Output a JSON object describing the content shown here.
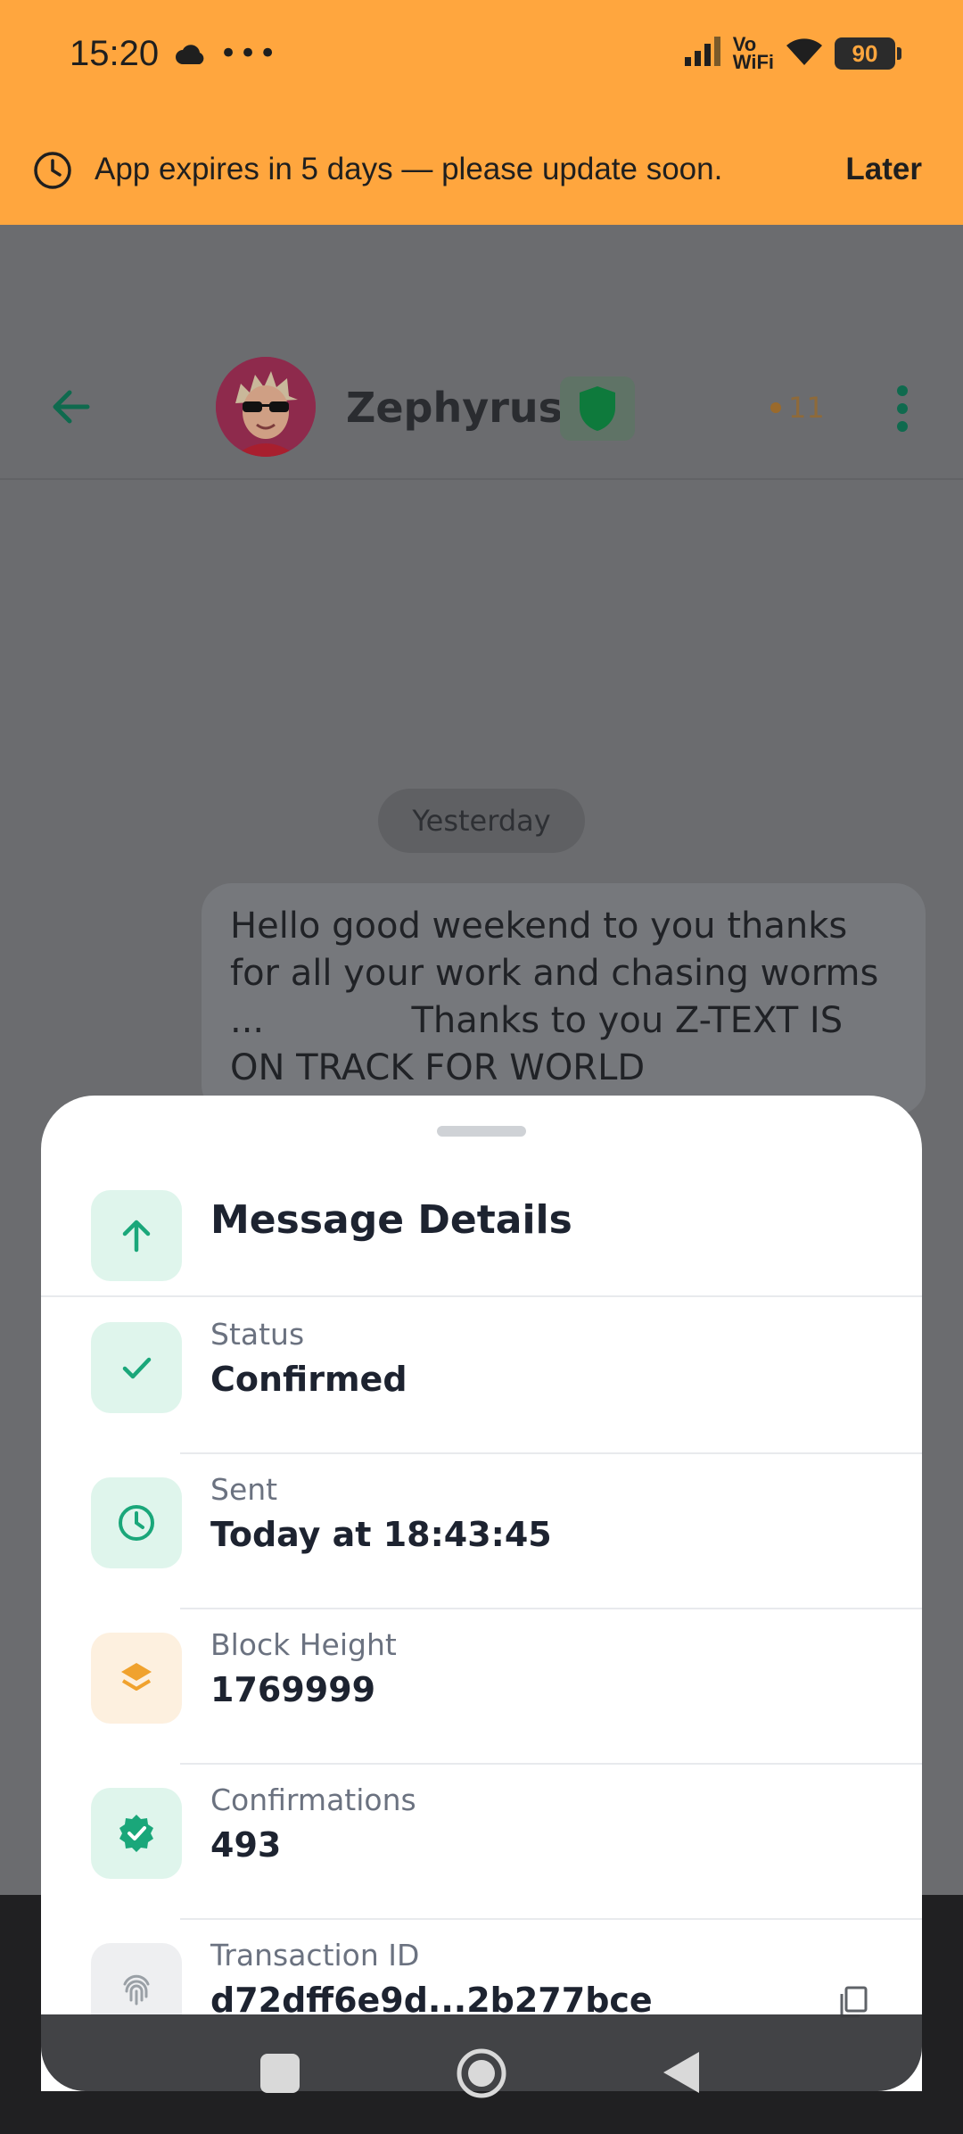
{
  "status_bar": {
    "time": "15:20",
    "dots": "•••",
    "network": "Vo\nWiFi",
    "battery": "90"
  },
  "banner": {
    "message": "App expires in 5 days — please update soon.",
    "action": "Later"
  },
  "chat": {
    "contact_name": "Zephyrus",
    "points": "11",
    "date_label": "Yesterday",
    "message": "Hello good weekend to you thanks\nfor all your work and chasing worms\n...             Thanks to you Z-TEXT IS\nON TRACK FOR WORLD"
  },
  "sheet": {
    "title": "Message Details",
    "rows": [
      {
        "label": "Status",
        "value": "Confirmed",
        "icon": "check-icon"
      },
      {
        "label": "Sent",
        "value": "Today at 18:43:45",
        "icon": "clock-icon"
      },
      {
        "label": "Block Height",
        "value": "1769999",
        "icon": "layers-icon"
      },
      {
        "label": "Confirmations",
        "value": "493",
        "icon": "verified-badge-icon"
      },
      {
        "label": "Transaction ID",
        "value": "d72dff6e9d...2b277bce",
        "icon": "fingerprint-icon"
      }
    ]
  },
  "colors": {
    "banner": "#ffa63e",
    "accent_green": "#1aa77a",
    "accent_orange": "#f0a22e",
    "sheet_bg": "#ffffff"
  }
}
